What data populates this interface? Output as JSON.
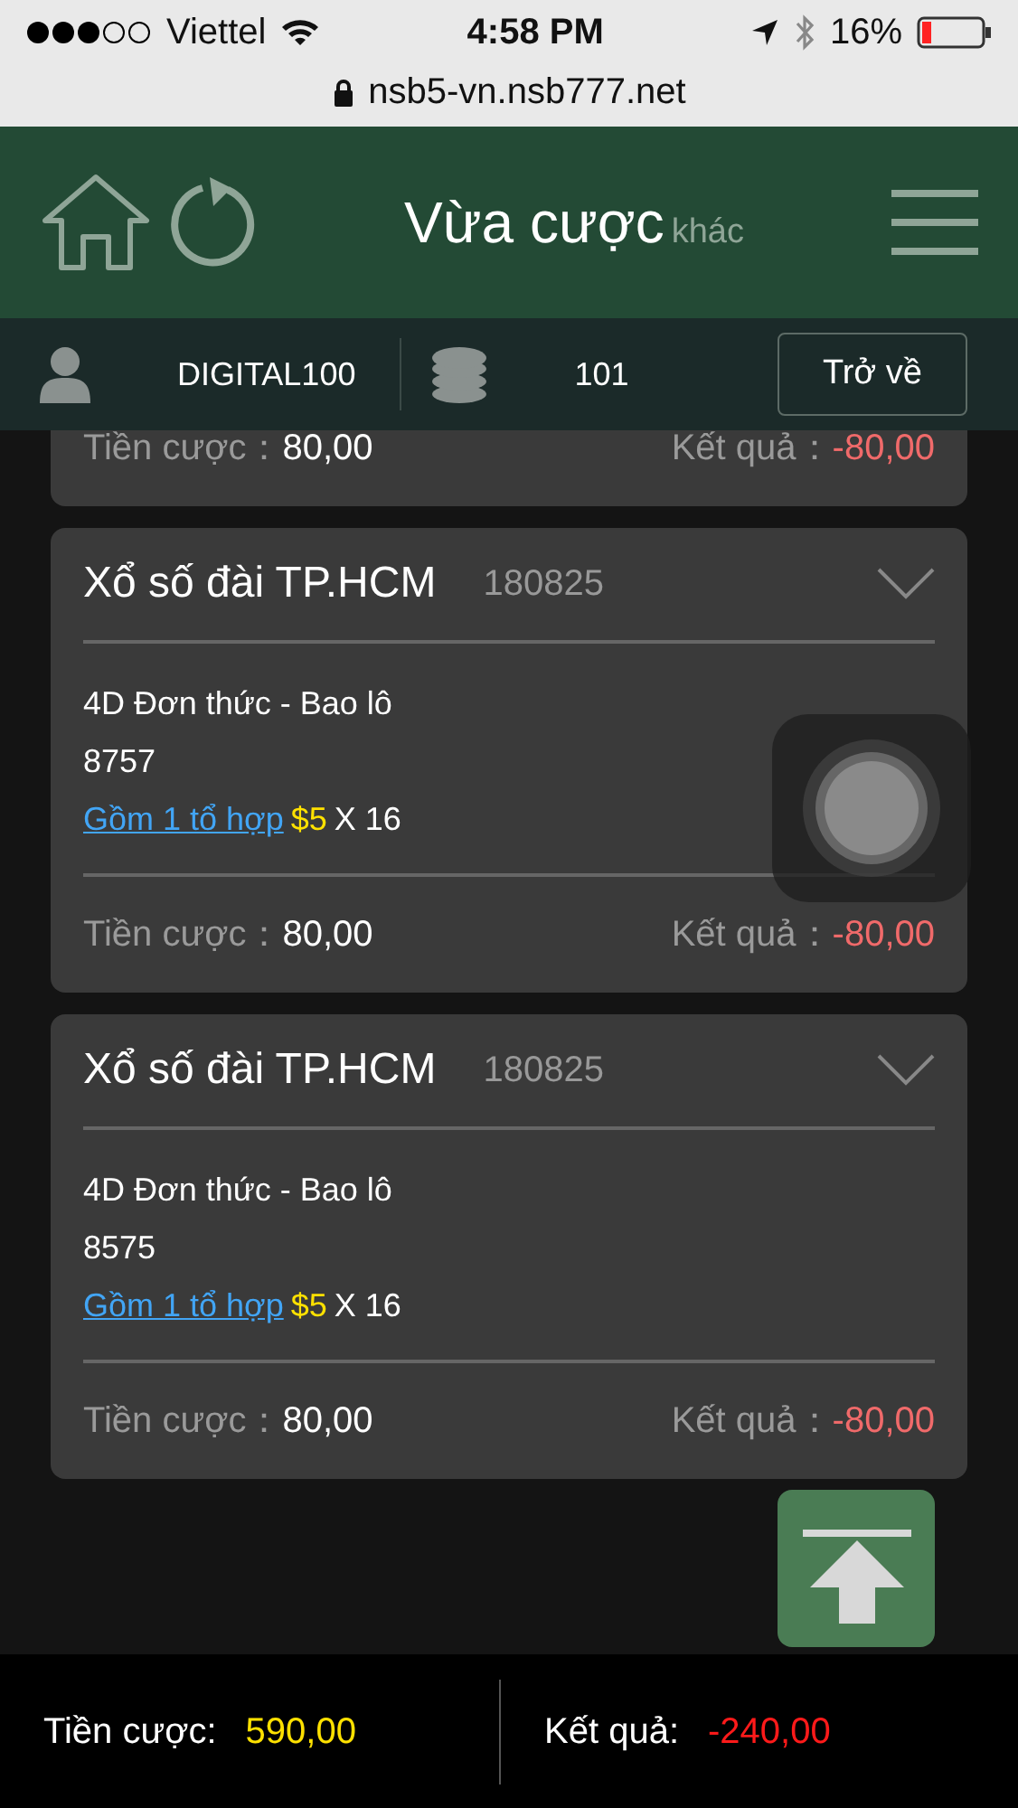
{
  "status_bar": {
    "carrier": "Viettel",
    "time": "4:58 PM",
    "battery": "16%"
  },
  "address_bar": {
    "url": "nsb5-vn.nsb777.net"
  },
  "header": {
    "title": "Vừa cược",
    "subtitle": "khác"
  },
  "account": {
    "username": "DIGITAL100",
    "balance": "101",
    "back_button": "Trở về"
  },
  "bets": [
    {
      "kind": "partial",
      "stake_label": "Tiền cược：",
      "stake": "80,00",
      "result_label": "Kết quả：",
      "result": "-80,00"
    },
    {
      "kind": "full",
      "title": "Xổ số đài TP.HCM",
      "draw": "180825",
      "bet_type": "4D Đơn thức - Bao lô",
      "number": "8757",
      "combo_link": "Gồm 1 tổ hợp",
      "unit": "$5",
      "multiplier": "X 16",
      "stake_label": "Tiền cược：",
      "stake": "80,00",
      "result_label": "Kết quả：",
      "result": "-80,00"
    },
    {
      "kind": "full",
      "title": "Xổ số đài TP.HCM",
      "draw": "180825",
      "bet_type": "4D Đơn thức - Bao lô",
      "number": "8575",
      "combo_link": "Gồm 1 tổ hợp",
      "unit": "$5",
      "multiplier": "X 16",
      "stake_label": "Tiền cược：",
      "stake": "80,00",
      "result_label": "Kết quả：",
      "result": "-80,00"
    }
  ],
  "totals": {
    "stake_label": "Tiền cược:",
    "stake": "590,00",
    "result_label": "Kết quả:",
    "result": "-240,00"
  }
}
